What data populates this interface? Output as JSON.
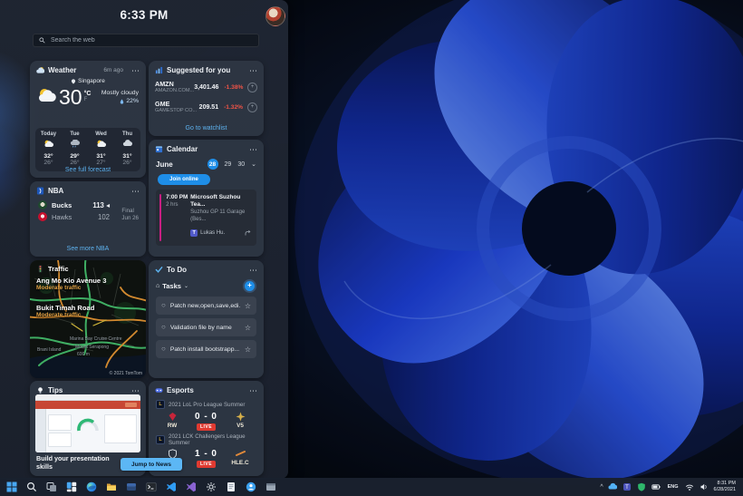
{
  "glyphs": {
    "more": "⋯",
    "chevron_down": "⌄",
    "chevron_up": "^",
    "star": "☆",
    "circle": "○",
    "home": "⌂",
    "winner_arrow": "◂",
    "plus": "+",
    "gear": "⚙",
    "teams_t": "T",
    "lol_l": "L"
  },
  "colors": {
    "accent_blue": "#1e8ee8",
    "link_blue": "#5eb3f0",
    "live_red": "#e03a31",
    "stock_down_red": "#ef5347",
    "traffic_orange": "#e0a044",
    "button_blue": "#5cb7f5"
  },
  "panel": {
    "time": "6:33 PM",
    "search_placeholder": "Search the web",
    "weather": {
      "title": "Weather",
      "updated": "6m ago",
      "location": "Singapore",
      "temperature": "30",
      "unit": "°C",
      "unit_alt": "F",
      "condition": "Mostly cloudy",
      "precipitation": "22%",
      "forecast": [
        {
          "day": "Today",
          "hi": "32°",
          "lo": "26°",
          "icon": "partly-sunny"
        },
        {
          "day": "Tue",
          "hi": "29°",
          "lo": "26°",
          "icon": "rain"
        },
        {
          "day": "Wed",
          "hi": "31°",
          "lo": "27°",
          "icon": "partly-sunny"
        },
        {
          "day": "Thu",
          "hi": "31°",
          "lo": "26°",
          "icon": "cloudy"
        }
      ],
      "link": "See full forecast"
    },
    "stocks": {
      "title": "Suggested for you",
      "rows": [
        {
          "symbol": "AMZN",
          "company": "AMAZON.COM...",
          "price": "3,401.46",
          "change": "-1.38%"
        },
        {
          "symbol": "GME",
          "company": "GAMESTOP CO...",
          "price": "209.51",
          "change": "-1.32%"
        }
      ],
      "link": "Go to watchlist"
    },
    "calendar": {
      "title": "Calendar",
      "month": "June",
      "selected_day": "28",
      "other_days": [
        "29",
        "30"
      ],
      "join_button": "Join online",
      "event": {
        "time": "7:00 PM",
        "duration": "2 hrs",
        "title": "Microsoft Suzhou Tea...",
        "location": "Suzhou GP 11 Garage (Bes...",
        "attendee": "Lukas Hu."
      }
    },
    "nba": {
      "title": "NBA",
      "team1": {
        "name": "Bucks",
        "score": "113"
      },
      "team2": {
        "name": "Hawks",
        "score": "102"
      },
      "status": "Final",
      "date": "Jun 26",
      "link": "See more NBA"
    },
    "traffic": {
      "title": "Traffic",
      "road1": {
        "name": "Ang Mo Kio Avenue 3",
        "status": "Moderate traffic"
      },
      "road2": {
        "name": "Bukit Timah Road",
        "status": "Moderate traffic"
      },
      "labels": {
        "a": "Marina Bay Cruise Centre",
        "b": "Mount Serapong",
        "c": "Brani Island",
        "d": "600 m"
      },
      "attribution": "© 2021 TomTom"
    },
    "todo": {
      "title": "To Do",
      "list_label": "Tasks",
      "tasks": [
        "Patch new,open,save,edi...",
        "Validation file by name",
        "Patch install bootstrapp..."
      ]
    },
    "tips": {
      "title": "Tips",
      "caption": "Build your presentation skills",
      "button": "Jump to News"
    },
    "esports": {
      "title": "Esports",
      "match1": {
        "league": "2021 LoL Pro League Summer",
        "team1": "RW",
        "team2": "V5",
        "score": "0 - 0",
        "status": "LIVE"
      },
      "match2": {
        "league": "2021 LCK Challengers League Summer",
        "team1": "",
        "team2": "HLE.C",
        "score": "1 - 0",
        "status": "LIVE"
      }
    }
  },
  "taskbar": {
    "icons": [
      "start",
      "search",
      "task-view",
      "widgets",
      "edge",
      "file-explorer",
      "folder-app",
      "terminal",
      "vscode",
      "visual-studio",
      "settings",
      "notepad",
      "people",
      "app-window"
    ],
    "tray_icons": [
      "hidden-icons",
      "onedrive",
      "teams",
      "security",
      "battery",
      "network",
      "volume"
    ],
    "language": "ENG",
    "time": "8:31 PM",
    "date": "6/28/2021"
  }
}
